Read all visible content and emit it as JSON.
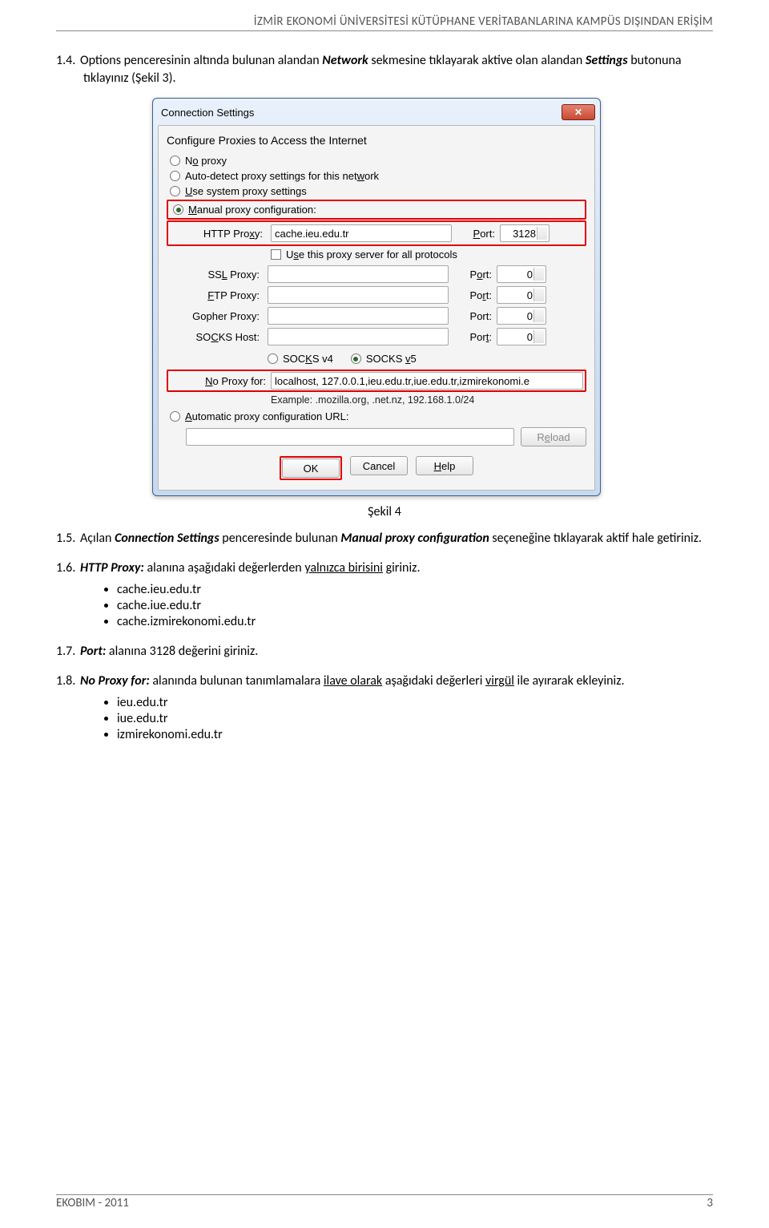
{
  "header": "İZMİR EKONOMİ ÜNİVERSİTESİ KÜTÜPHANE VERİTABANLARINA KAMPÜS DIŞINDAN ERİŞİM",
  "s14": {
    "num": "1.4.",
    "pre": "Options penceresinin altında bulunan alandan ",
    "em1": "Network",
    "mid": " sekmesine tıklayarak aktive olan alandan ",
    "em2": "Settings",
    "post": " butonuna tıklayınız (Şekil 3)."
  },
  "dialog": {
    "title": "Connection Settings",
    "heading": "Configure Proxies to Access the Internet",
    "r_noproxy": "No proxy",
    "r_auto": "Auto-detect proxy settings for this network",
    "r_system": "Use system proxy settings",
    "r_manual": "Manual proxy configuration:",
    "lab_http": "HTTP Proxy:",
    "val_http": "cache.ieu.edu.tr",
    "lab_port": "Port:",
    "val_http_port": "3128",
    "chk_all": "Use this proxy server for all protocols",
    "lab_ssl": "SSL Proxy:",
    "lab_ftp": "FTP Proxy:",
    "lab_gopher": "Gopher Proxy:",
    "lab_socks": "SOCKS Host:",
    "zero": "0",
    "socks_v4": "SOCKS v4",
    "socks_v5": "SOCKS v5",
    "lab_noproxy": "No Proxy for:",
    "val_noproxy": "localhost, 127.0.0.1,ieu.edu.tr,iue.edu.tr,izmirekonomi.e",
    "example": "Example: .mozilla.org, .net.nz, 192.168.1.0/24",
    "r_autourl": "Automatic proxy configuration URL:",
    "btn_reload": "Reload",
    "btn_ok": "OK",
    "btn_cancel": "Cancel",
    "btn_help": "Help"
  },
  "caption": "Şekil 4",
  "s15": {
    "num": "1.5.",
    "pre": "Açılan ",
    "em1": "Connection Settings",
    "mid": " penceresinde bulunan ",
    "em2": "Manual proxy configuration",
    "post": " seçeneğine tıklayarak aktif hale getiriniz."
  },
  "s16": {
    "num": "1.6.",
    "em": "HTTP Proxy:",
    "mid": " alanına aşağıdaki değerlerden ",
    "u": "yalnızca birisini",
    "post": " giriniz."
  },
  "b16": [
    "cache.ieu.edu.tr",
    "cache.iue.edu.tr",
    "cache.izmirekonomi.edu.tr"
  ],
  "s17": {
    "num": "1.7.",
    "em": "Port:",
    "post": " alanına 3128 değerini giriniz."
  },
  "s18": {
    "num": "1.8.",
    "em": "No Proxy for:",
    "mid1": " alanında bulunan tanımlamalara ",
    "u1": "ilave olarak",
    "mid2": " aşağıdaki değerleri ",
    "u2": "virgül",
    "post": " ile ayırarak ekleyiniz."
  },
  "b18": [
    "ieu.edu.tr",
    "iue.edu.tr",
    "izmirekonomi.edu.tr"
  ],
  "footer_left": "EKOBIM - 2011",
  "footer_right": "3"
}
